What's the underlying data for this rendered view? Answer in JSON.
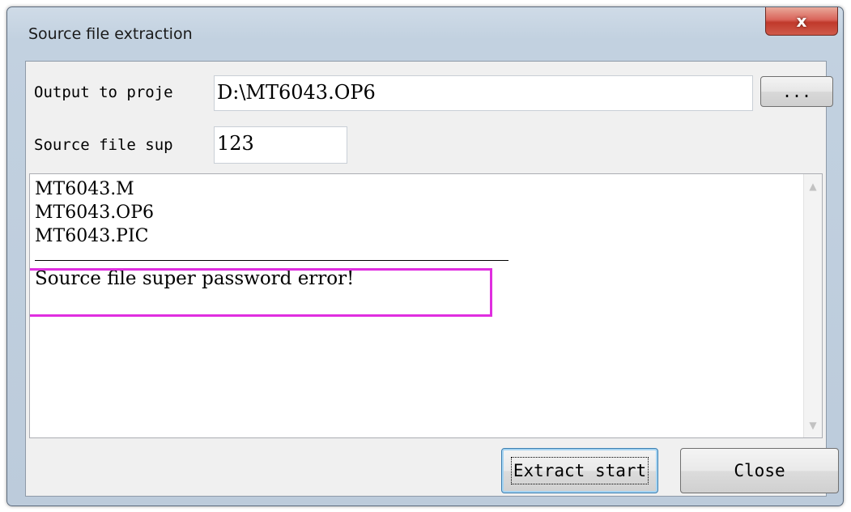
{
  "window": {
    "title": "Source file extraction",
    "close_glyph": "x"
  },
  "form": {
    "output_label": "Output to proje",
    "output_value": "D:\\MT6043.OP6",
    "browse_label": "...",
    "password_label": "Source file sup",
    "password_value": "123"
  },
  "log": {
    "lines": [
      "MT6043.M",
      "MT6043.OP6",
      "MT6043.PIC"
    ],
    "error": "Source file super password error!",
    "highlight_color": "#e02ee0"
  },
  "buttons": {
    "extract_label": "Extract start",
    "close_label": "Close"
  },
  "colors": {
    "window_frame": "#bccbdb",
    "close_button": "#c0392b"
  }
}
